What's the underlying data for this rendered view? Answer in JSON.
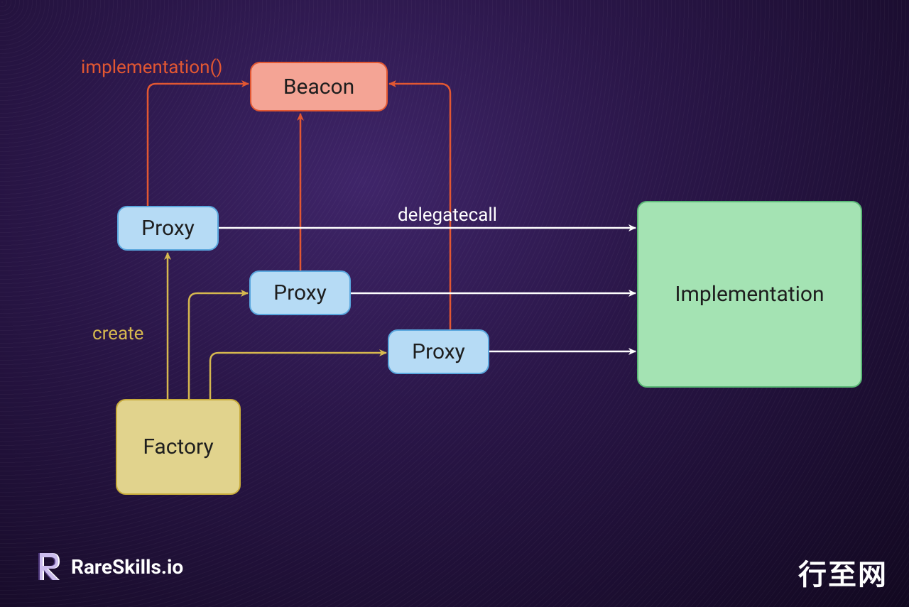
{
  "nodes": {
    "beacon": "Beacon",
    "proxy1": "Proxy",
    "proxy2": "Proxy",
    "proxy3": "Proxy",
    "factory": "Factory",
    "implementation": "Implementation"
  },
  "labels": {
    "implementation_call": "implementation()",
    "create": "create",
    "delegatecall": "delegatecall"
  },
  "colors": {
    "orange": "#e25732",
    "gold": "#d6b84f",
    "white": "#ffffff"
  },
  "footer": {
    "brand": "RareSkills.io",
    "right": "行至网"
  }
}
